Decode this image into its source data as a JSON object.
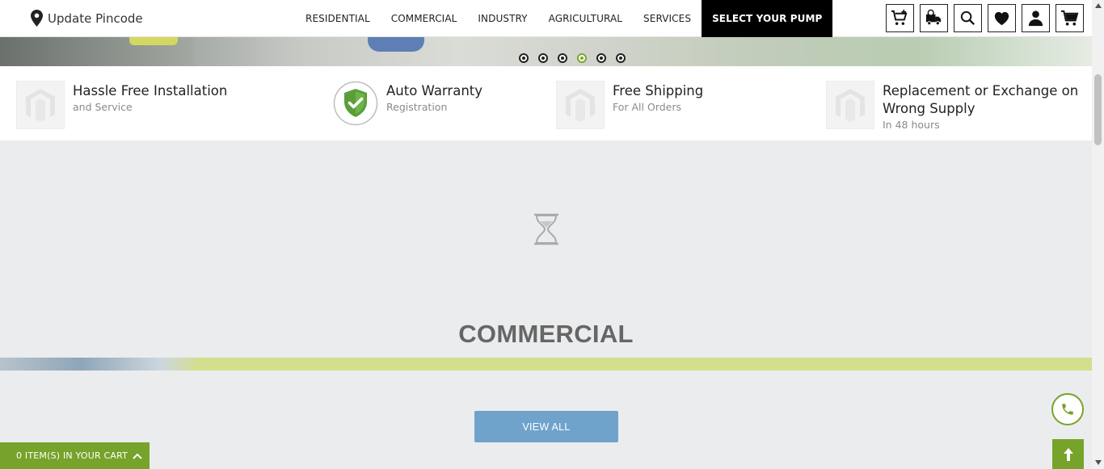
{
  "header": {
    "pincode_label": "Update Pincode",
    "nav": [
      {
        "label": "RESIDENTIAL"
      },
      {
        "label": "COMMERCIAL"
      },
      {
        "label": "INDUSTRY"
      },
      {
        "label": "AGRICULTURAL"
      },
      {
        "label": "SERVICES"
      },
      {
        "label": "SELECT YOUR PUMP"
      }
    ],
    "icons": [
      "cart-plus-icon",
      "delivery-truck-icon",
      "search-icon",
      "heart-icon",
      "user-icon",
      "cart-icon"
    ]
  },
  "slider": {
    "dot_count": 6,
    "active_dot": 4
  },
  "features": [
    {
      "title": "Hassle Free Installation",
      "subtitle": "and Service",
      "icon": "placeholder-logo-icon"
    },
    {
      "title": "Auto Warranty",
      "subtitle": "Registration",
      "icon": "shield-check-icon"
    },
    {
      "title": "Free Shipping",
      "subtitle": "For All Orders",
      "icon": "placeholder-logo-icon"
    },
    {
      "title": "Replacement or Exchange on Wrong Supply",
      "subtitle": "In 48 hours",
      "icon": "placeholder-logo-icon"
    }
  ],
  "section": {
    "title": "COMMERCIAL",
    "view_all_label": "VIEW ALL",
    "loader_icon": "hourglass-icon"
  },
  "cart_bar": {
    "label": "0 ITEM(S) IN YOUR CART"
  },
  "colors": {
    "accent_green": "#76a32a",
    "view_all_blue": "#6fa3cb",
    "band_green": "#d3df8c",
    "nav_active_bg": "#000000"
  }
}
